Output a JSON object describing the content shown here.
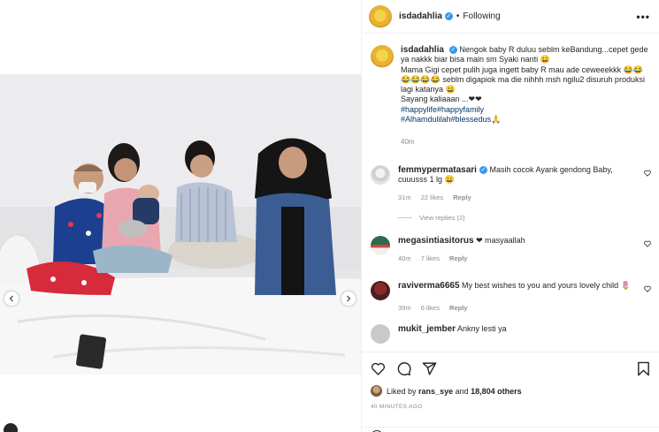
{
  "header": {
    "username": "isdadahlia",
    "separator": "•",
    "follow_state": "Following",
    "more_icon": "more-horizontal-icon"
  },
  "caption": {
    "username": "isdadahlia",
    "text": "Nengok baby R duluu seblm keBandung...cepet gede ya nakkk biar bisa main sm Syaki nanti 😀\nMama Gigi cepet pulih juga ingett baby R mau ade ceweeekkk 😂😂😂😂😂😂 seblm digapiok ma die nihhh msh ngilu2 disuruh produksi lagi katanya 😀\nSayang kaliaaan ...❤❤",
    "hashtags": [
      "#happylife#happyfamily",
      "#Alhamdulilah#blessedus🙏"
    ],
    "time": "40m"
  },
  "comments": [
    {
      "username": "femmypermatasari",
      "verified": true,
      "text": "Masih cocok Ayank gendong Baby, cuuusss 1 lg 😀",
      "time": "31m",
      "likes": "22 likes",
      "reply": "Reply",
      "view_replies": "View replies (2)"
    },
    {
      "username": "megasintiasitorus",
      "verified": false,
      "text": "❤ masyaallah",
      "time": "40m",
      "likes": "7 likes",
      "reply": "Reply"
    },
    {
      "username": "raviverma6665",
      "verified": false,
      "text": "My best wishes to you and yours lovely child 🌷",
      "time": "39m",
      "likes": "6 likes",
      "reply": "Reply"
    },
    {
      "username": "mukit_jember",
      "verified": false,
      "text": "Ankny lesti ya"
    }
  ],
  "actions": {
    "icons": [
      "heart-icon",
      "comment-icon",
      "share-icon",
      "bookmark-icon"
    ],
    "liked_by_prefix": "Liked by",
    "liked_by_user": "rans_sye",
    "liked_by_and": "and",
    "liked_by_others": "18,804 others",
    "time_ago": "40 MINUTES AGO"
  },
  "colors": {
    "link": "#00376b",
    "secondary_text": "#8e8e8e",
    "verified": "#3897f0",
    "border": "#efefef"
  }
}
